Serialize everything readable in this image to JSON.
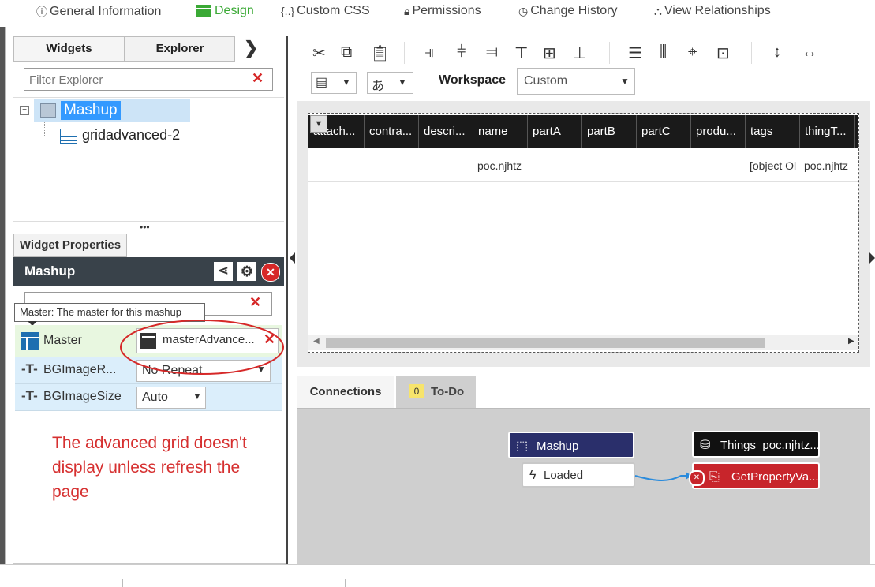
{
  "nav": {
    "items": [
      {
        "label": "General Information",
        "icon": "info-icon"
      },
      {
        "label": "Design",
        "icon": "design-icon",
        "active": true
      },
      {
        "label": "Custom CSS",
        "icon": "braces-icon"
      },
      {
        "label": "Permissions",
        "icon": "lock-icon"
      },
      {
        "label": "Change History",
        "icon": "clock-icon"
      },
      {
        "label": "View Relationships",
        "icon": "relationships-icon"
      }
    ]
  },
  "left": {
    "tabs": {
      "widgets": "Widgets",
      "explorer": "Explorer"
    },
    "filter_placeholder": "Filter Explorer",
    "tree": {
      "root": "Mashup",
      "child": "gridadvanced-2"
    },
    "widget_properties_tab": "Widget Properties",
    "props_header": "Mashup",
    "tooltip": "Master: The master for this mashup",
    "properties": [
      {
        "name": "Master",
        "value": "masterAdvance..."
      },
      {
        "name": "BGImageR...",
        "value": "No Repeat"
      },
      {
        "name": "BGImageSize",
        "value": "Auto"
      }
    ],
    "note": "The advanced grid doesn't display unless refresh the page"
  },
  "toolbar": {
    "workspace_label": "Workspace",
    "workspace_value": "Custom"
  },
  "grid": {
    "columns": [
      "attach...",
      "contra...",
      "descri...",
      "name",
      "partA",
      "partB",
      "partC",
      "produ...",
      "tags",
      "thingT..."
    ],
    "row": {
      "name": "poc.njhtz",
      "tags": "[object Ol",
      "thingT": "poc.njhtz"
    }
  },
  "bottom": {
    "tabs": {
      "connections": "Connections",
      "todo": "To-Do",
      "todo_count": "0"
    },
    "nodes": {
      "mashup": "Mashup",
      "loaded": "Loaded",
      "things": "Things_poc.njhtz...",
      "getprop": "GetPropertyVa..."
    }
  },
  "colors": {
    "accent_green": "#3aa935",
    "node_navy": "#2a2f6b",
    "node_red": "#c8252b",
    "annotation_red": "#d63030"
  }
}
